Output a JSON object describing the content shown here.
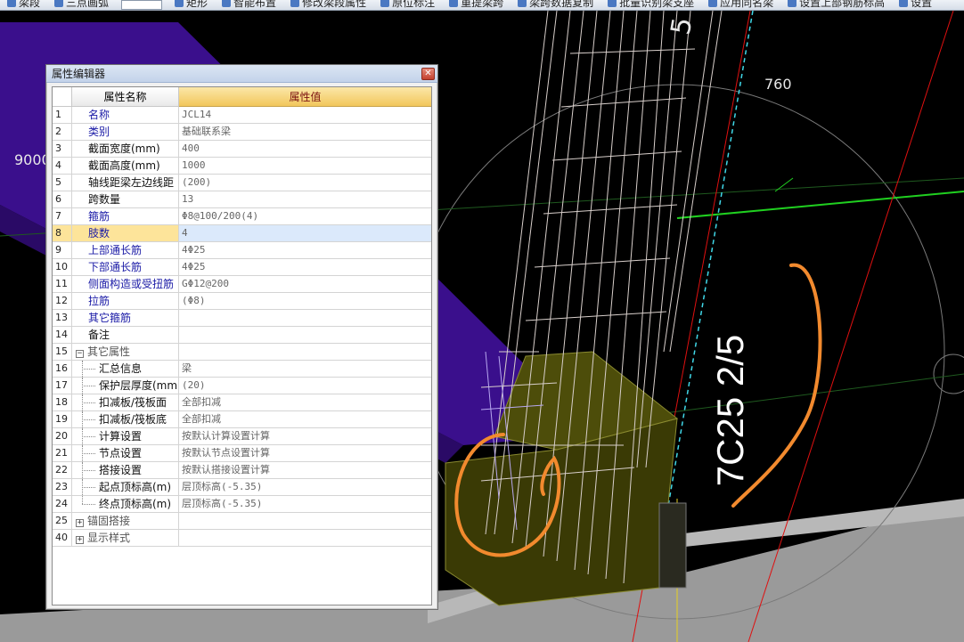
{
  "toolbar": {
    "items": [
      "梁段",
      "三点画弧",
      "矩形",
      "智能布置",
      "修改梁段属性",
      "原位标注",
      "重提梁跨",
      "梁跨数据复制",
      "批量识别梁支座",
      "应用同名梁",
      "设置上部钢筋标高",
      "设置"
    ]
  },
  "viewport": {
    "dim_label_760": "760",
    "dim_label_9000": "9000",
    "dim_label_top": "5",
    "handwritten_annotation": "7C25 2/5",
    "colors": {
      "background": "#000000",
      "purple_slab": "#3a0f8c",
      "footing_fill": "#3a3a05",
      "floor_grey": "#9a9a9a",
      "axis_red": "#e01010",
      "axis_green": "#20d020",
      "axis_cyan": "#40d8e8",
      "annotation_orange": "#f28a2e",
      "rebar_cage": "#d8cfcb"
    }
  },
  "editor": {
    "title": "属性编辑器",
    "close_symbol": "✕",
    "header": {
      "name": "属性名称",
      "value": "属性值"
    },
    "rows": [
      {
        "num": "1",
        "name": "名称",
        "value": "JCL14",
        "style": "blue"
      },
      {
        "num": "2",
        "name": "类别",
        "value": "基础联系梁",
        "style": "blue"
      },
      {
        "num": "3",
        "name": "截面宽度(mm)",
        "value": "400",
        "style": "black"
      },
      {
        "num": "4",
        "name": "截面高度(mm)",
        "value": "1000",
        "style": "black"
      },
      {
        "num": "5",
        "name": "轴线距梁左边线距",
        "value": "(200)",
        "style": "black"
      },
      {
        "num": "6",
        "name": "跨数量",
        "value": "13",
        "style": "black"
      },
      {
        "num": "7",
        "name": "箍筋",
        "value": "Φ8@100/200(4)",
        "style": "blue"
      },
      {
        "num": "8",
        "name": "肢数",
        "value": "4",
        "style": "blue",
        "selected": true
      },
      {
        "num": "9",
        "name": "上部通长筋",
        "value": "4Φ25",
        "style": "blue"
      },
      {
        "num": "10",
        "name": "下部通长筋",
        "value": "4Φ25",
        "style": "blue"
      },
      {
        "num": "11",
        "name": "侧面构造或受扭筋",
        "value": "GΦ12@200",
        "style": "blue"
      },
      {
        "num": "12",
        "name": "拉筋",
        "value": "(Φ8)",
        "style": "blue"
      },
      {
        "num": "13",
        "name": "其它箍筋",
        "value": "",
        "style": "blue"
      },
      {
        "num": "14",
        "name": "备注",
        "value": "",
        "style": "black"
      },
      {
        "num": "15",
        "name": "其它属性",
        "value": "",
        "style": "group",
        "expander": "−"
      },
      {
        "num": "16",
        "name": "汇总信息",
        "value": "梁",
        "style": "child"
      },
      {
        "num": "17",
        "name": "保护层厚度(mm)",
        "value": "(20)",
        "style": "child"
      },
      {
        "num": "18",
        "name": "扣减板/筏板面",
        "value": "全部扣减",
        "style": "child"
      },
      {
        "num": "19",
        "name": "扣减板/筏板底",
        "value": "全部扣减",
        "style": "child"
      },
      {
        "num": "20",
        "name": "计算设置",
        "value": "按默认计算设置计算",
        "style": "child"
      },
      {
        "num": "21",
        "name": "节点设置",
        "value": "按默认节点设置计算",
        "style": "child"
      },
      {
        "num": "22",
        "name": "搭接设置",
        "value": "按默认搭接设置计算",
        "style": "child"
      },
      {
        "num": "23",
        "name": "起点顶标高(m)",
        "value": "层顶标高(-5.35)",
        "style": "child"
      },
      {
        "num": "24",
        "name": "终点顶标高(m)",
        "value": "层顶标高(-5.35)",
        "style": "child last"
      },
      {
        "num": "25",
        "name": "锚固搭接",
        "value": "",
        "style": "group",
        "expander": "+"
      },
      {
        "num": "40",
        "name": "显示样式",
        "value": "",
        "style": "group",
        "expander": "+"
      }
    ]
  }
}
